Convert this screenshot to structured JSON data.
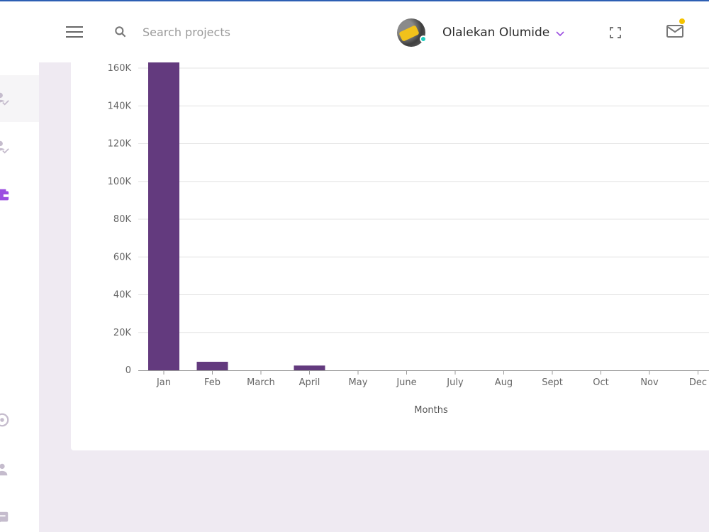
{
  "header": {
    "search": {
      "placeholder": "Search projects"
    },
    "user": {
      "name": "Olalekan Olumide",
      "status_color": "#1ccfc0"
    },
    "icons": [
      "menu-icon",
      "search-icon",
      "chevron-down-icon",
      "fullscreen-icon",
      "mail-icon"
    ],
    "notification_dot_color": "#f5c300"
  },
  "sidebar": {
    "items": [
      {
        "icon": "person-check-icon",
        "active": true
      },
      {
        "icon": "person-check-icon",
        "active": false
      },
      {
        "icon": "wallet-icon",
        "active": false,
        "color": "#9b4de0"
      },
      {
        "icon": "support-icon",
        "active": false
      },
      {
        "icon": "person-icon",
        "active": false
      },
      {
        "icon": "message-icon",
        "active": false
      }
    ]
  },
  "chart_data": {
    "type": "bar",
    "categories": [
      "Jan",
      "Feb",
      "March",
      "April",
      "May",
      "June",
      "July",
      "Aug",
      "Sept",
      "Oct",
      "Nov",
      "Dec"
    ],
    "values": [
      163000,
      4500,
      0,
      2500,
      0,
      0,
      0,
      0,
      0,
      0,
      0,
      0
    ],
    "xlabel": "Months",
    "ylabel": "",
    "ylim": [
      0,
      160000
    ],
    "yticks": [
      "0",
      "20K",
      "40K",
      "60K",
      "80K",
      "100K",
      "120K",
      "140K",
      "160K"
    ],
    "grid": true,
    "bar_color": "#633a7e"
  }
}
